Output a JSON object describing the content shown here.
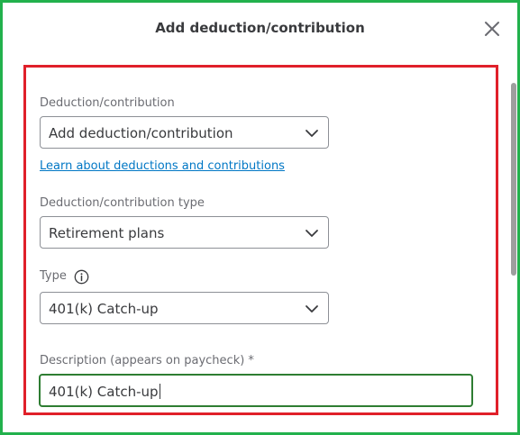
{
  "dialog": {
    "title": "Add deduction/contribution",
    "close_icon": "close-icon"
  },
  "form": {
    "deduction": {
      "label": "Deduction/contribution",
      "value": "Add deduction/contribution"
    },
    "learn_link": "Learn about deductions and contributions",
    "deduction_type": {
      "label": "Deduction/contribution type",
      "value": "Retirement plans"
    },
    "type": {
      "label": "Type",
      "info_icon": "info-icon",
      "value": "401(k) Catch-up"
    },
    "description": {
      "label": "Description (appears on paycheck) *",
      "value": "401(k) Catch-up"
    }
  },
  "colors": {
    "outer_frame": "#22b14c",
    "highlight_frame": "#e0202a",
    "link": "#0077c5",
    "focused_input_border": "#2e7d32"
  }
}
